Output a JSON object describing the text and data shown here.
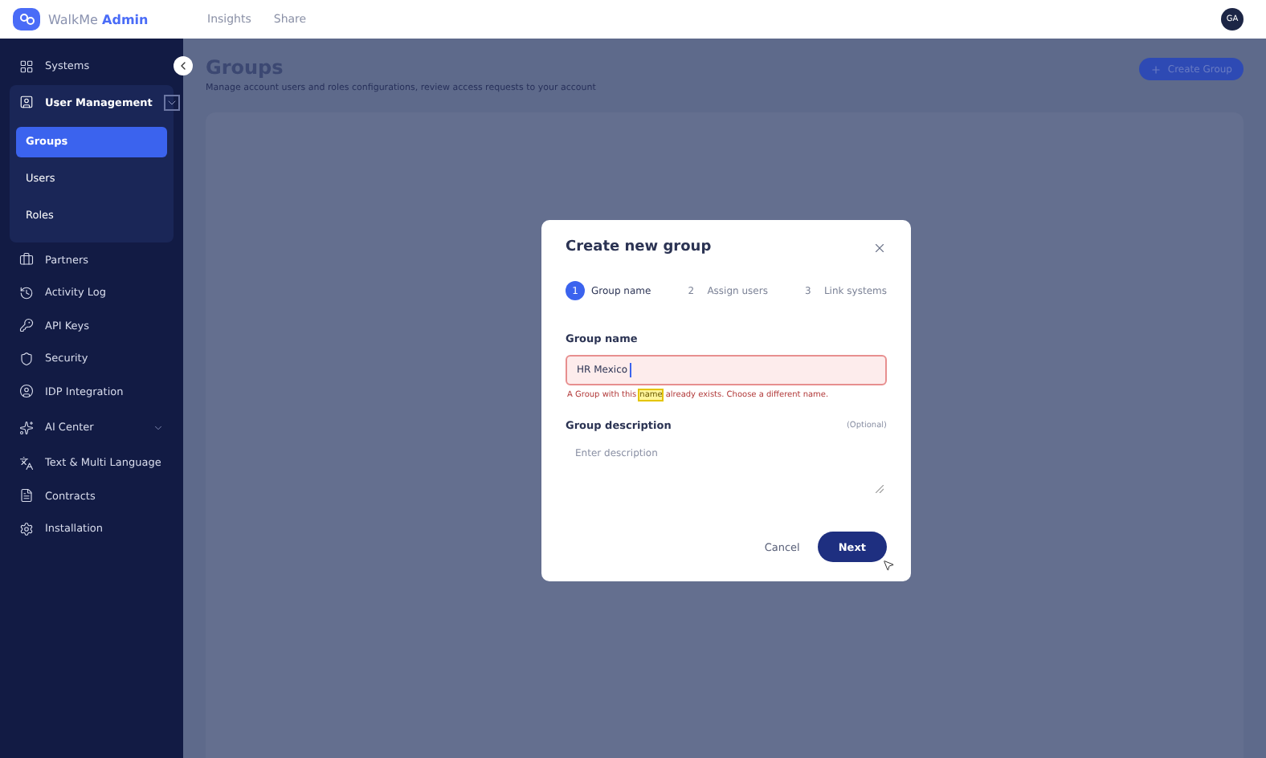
{
  "topbar": {
    "logo": {
      "brand": "WalkMe",
      "product": "Admin"
    },
    "links": [
      "Insights",
      "Share"
    ],
    "avatar": "GA"
  },
  "sidebar": {
    "items": [
      {
        "kind": "item",
        "label": "Systems"
      },
      {
        "kind": "group",
        "label": "User Management",
        "expanded": true,
        "children": [
          {
            "label": "Groups",
            "selected": true
          },
          {
            "label": "Users",
            "selected": false
          },
          {
            "label": "Roles",
            "selected": false
          }
        ]
      },
      {
        "kind": "item",
        "label": "Partners"
      },
      {
        "kind": "item",
        "label": "Activity Log"
      },
      {
        "kind": "item",
        "label": "API Keys"
      },
      {
        "kind": "item",
        "label": "Security"
      },
      {
        "kind": "item",
        "label": "IDP Integration"
      },
      {
        "kind": "group",
        "label": "AI Center",
        "expanded": false
      },
      {
        "kind": "item",
        "label": "Text & Multi Language"
      },
      {
        "kind": "item",
        "label": "Contracts"
      },
      {
        "kind": "item",
        "label": "Installation"
      }
    ]
  },
  "page": {
    "title": "Groups",
    "subtitle": "Manage account users and roles configurations, review access requests to your account",
    "action": "Create Group"
  },
  "dialog": {
    "title": "Create new group",
    "steps": [
      {
        "number": "1",
        "label": "Group name",
        "selected": true
      },
      {
        "number": "2",
        "label": "Assign users",
        "selected": false
      },
      {
        "number": "3",
        "label": "Link systems",
        "selected": false
      }
    ],
    "name_field": {
      "label": "Group name",
      "value": "HR Mexico",
      "invalid": true,
      "error": [
        {
          "text": "A Group with this",
          "highlighted": false
        },
        {
          "text": "name",
          "highlighted": true
        },
        {
          "text": "already exists. Choose a different name.",
          "highlighted": false
        }
      ]
    },
    "description_field": {
      "label": "Group description",
      "optional": "(Optional)",
      "placeholder": "Enter description"
    },
    "buttons": [
      {
        "kind": "secondary",
        "label": "Cancel"
      },
      {
        "kind": "primary",
        "label": "Next"
      }
    ]
  }
}
